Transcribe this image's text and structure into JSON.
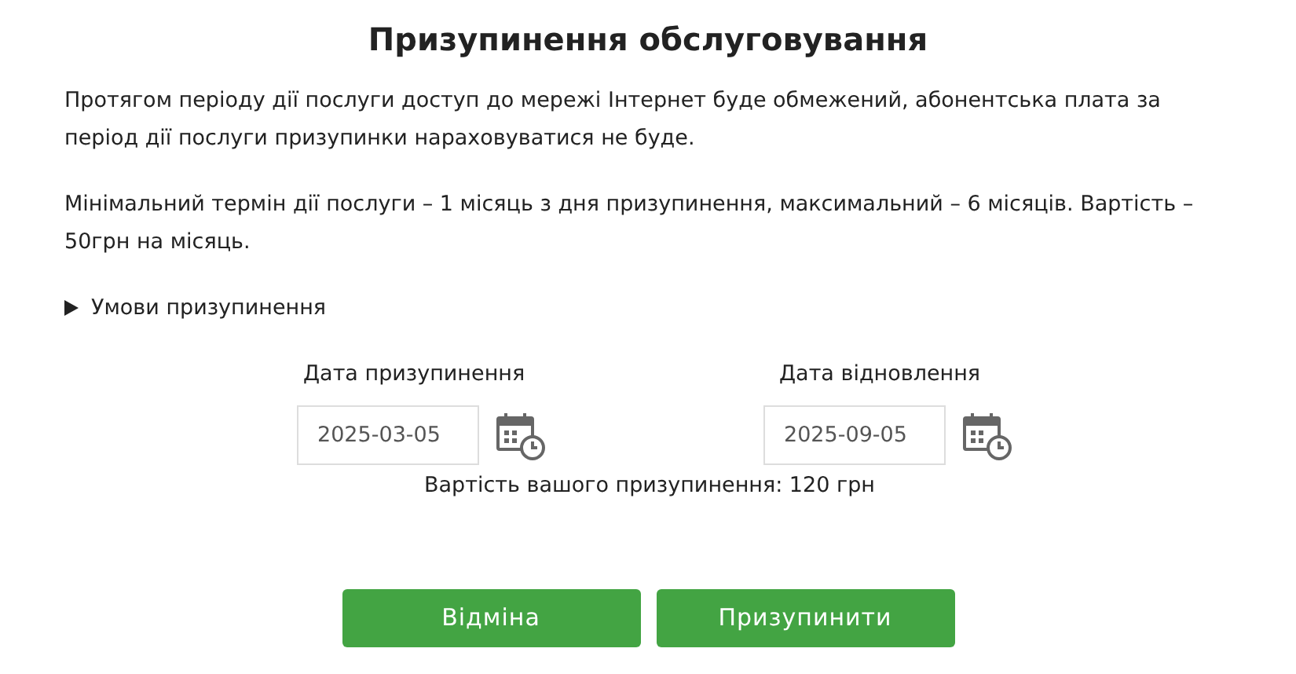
{
  "title": "Призупинення обслуговування",
  "paragraphs": [
    "Протягом періоду дії послуги доступ до мережі Інтернет буде обмежений, абонентська плата за період дії послуги призупинки нараховуватися не буде.",
    "Мінімальний термін дії послуги – 1 місяць з дня призупинення, максимальний – 6 місяців. Вартість – 50грн на місяць."
  ],
  "conditions": {
    "label": "Умови призупинення",
    "expanded": false
  },
  "dates": [
    {
      "label": "Дата призупинення",
      "value": "2025-03-05"
    },
    {
      "label": "Дата відновлення",
      "value": "2025-09-05"
    }
  ],
  "cost": "Вартість вашого призупинення: 120 грн",
  "buttons": [
    "Відміна",
    "Призупинити"
  ]
}
